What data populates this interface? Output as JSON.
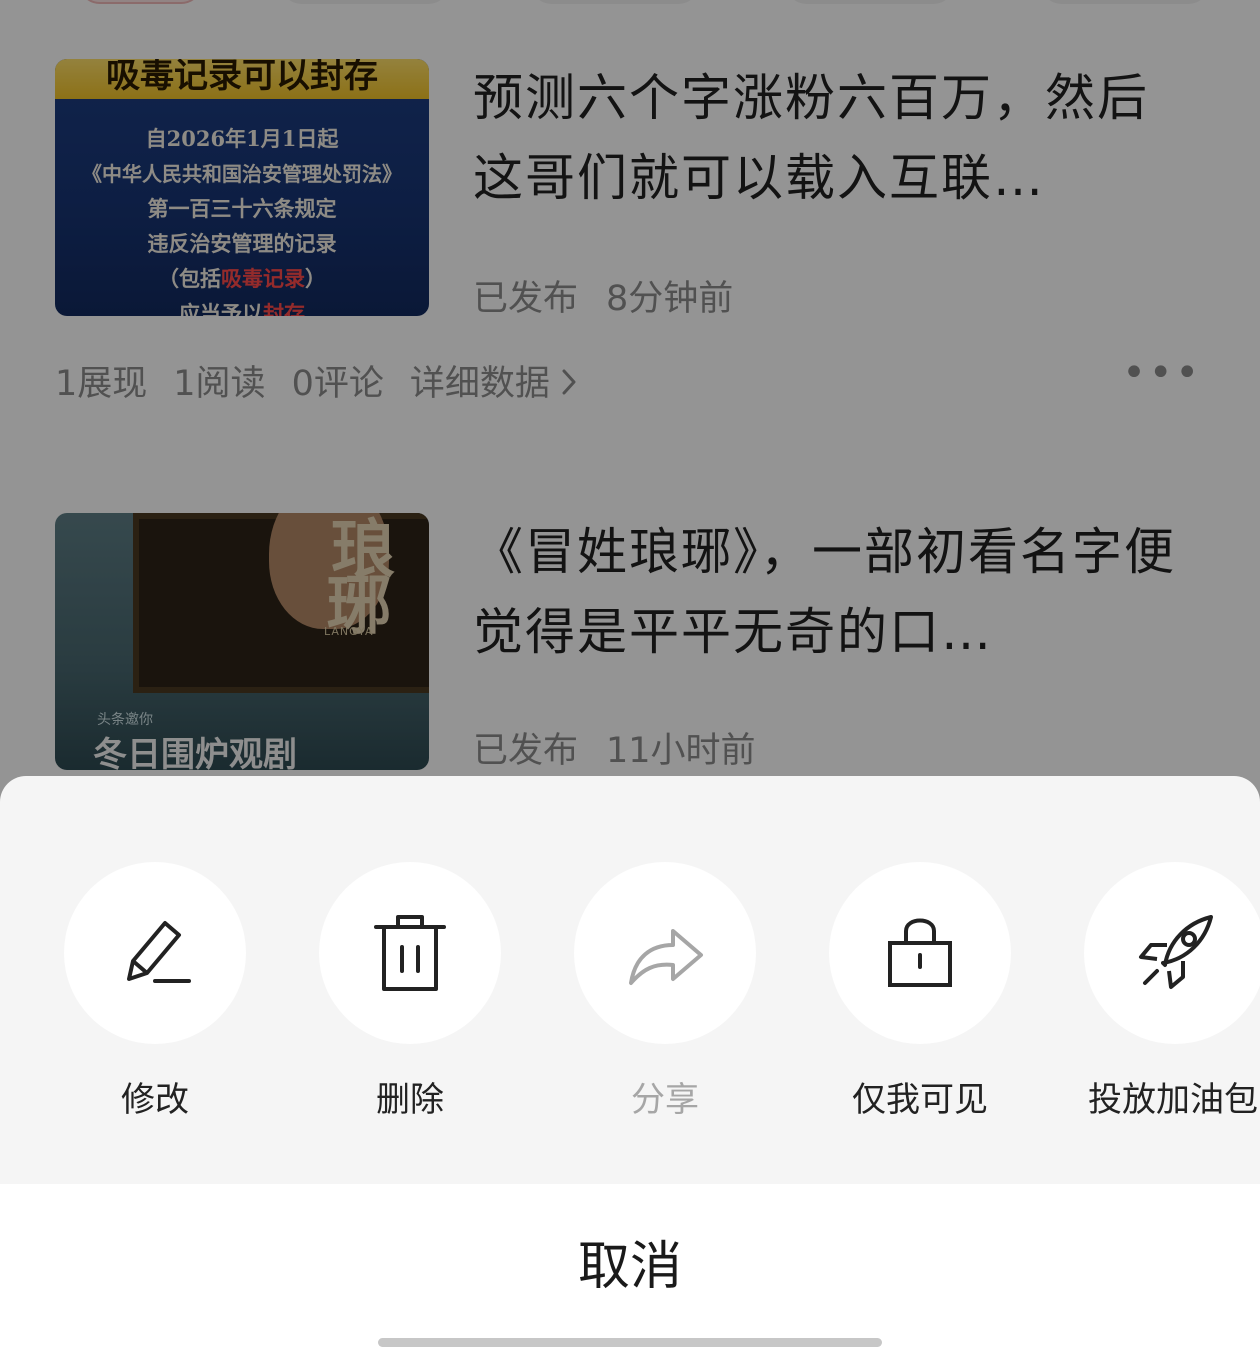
{
  "feed": {
    "articles": [
      {
        "thumbnail": {
          "banner": "吸毒记录可以封存",
          "lines": [
            "自2026年1月1日起",
            "《中华人民共和国治安管理处罚法》",
            "第一百三十六条规定",
            "违反治安管理的记录"
          ],
          "line5_pre": "（包括",
          "line5_hl": "吸毒记录",
          "line5_post": "）",
          "line6_pre": "应当予以",
          "line6_hl": "封存"
        },
        "title": "预测六个字涨粉六百万，然后这哥们就可以载入互联…",
        "status": "已发布",
        "time": "8分钟前",
        "stats": {
          "impressions": "1展现",
          "reads": "1阅读",
          "comments": "0评论",
          "detail_link": "详细数据"
        }
      },
      {
        "thumbnail": {
          "poster_char1": "琅",
          "poster_char2": "琊",
          "poster_en": "LANGYA",
          "tag": "头条邀你",
          "tag2": "冬日围炉观剧"
        },
        "title": "《冒姓琅琊》，一部初看名字便觉得是平平无奇的口…",
        "status": "已发布",
        "time": "11小时前"
      }
    ]
  },
  "action_sheet": {
    "actions": [
      {
        "label": "修改",
        "icon": "pencil-icon",
        "enabled": true
      },
      {
        "label": "删除",
        "icon": "trash-icon",
        "enabled": true
      },
      {
        "label": "分享",
        "icon": "share-arrow-icon",
        "enabled": false
      },
      {
        "label": "仅我可见",
        "icon": "lock-icon",
        "enabled": true
      },
      {
        "label": "投放加油包",
        "icon": "rocket-icon",
        "enabled": true
      }
    ],
    "cancel_label": "取消"
  },
  "colors": {
    "overlay": "rgba(0,0,0,0.42)",
    "sheet_bg": "#f5f5f5",
    "text_primary": "#222222",
    "text_disabled": "#a6a6a6"
  }
}
